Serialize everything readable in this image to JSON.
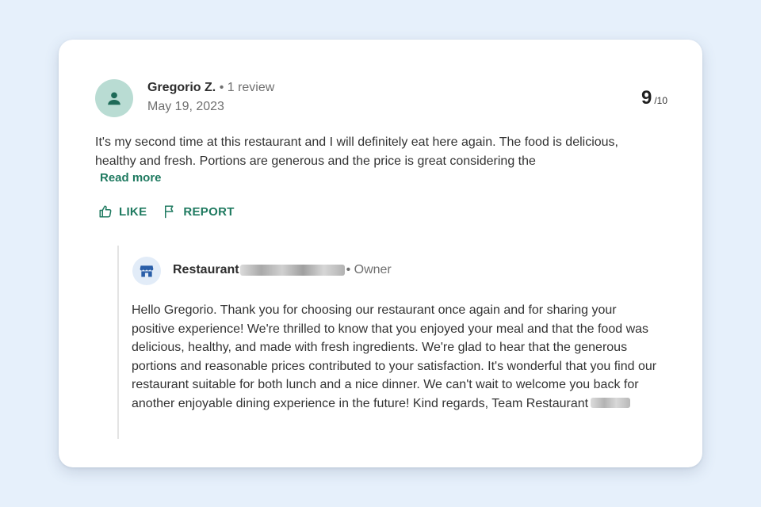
{
  "review": {
    "reviewer_name": "Gregorio Z.",
    "reviewer_meta": "• 1 review",
    "date": "May 19, 2023",
    "score": "9",
    "score_max": "/10",
    "text": "It's my second time at this restaurant and I will definitely eat here again. The food is delicious, healthy and fresh. Portions are generous and the price is great considering the",
    "read_more_label": "Read more",
    "actions": {
      "like_label": "LIKE",
      "report_label": "REPORT"
    }
  },
  "reply": {
    "owner_name": "Restaurant",
    "owner_role": "• Owner",
    "text": "Hello Gregorio. Thank you for choosing our restaurant once again and for sharing your positive experience! We're thrilled to know that you enjoyed your meal and that the food was delicious, healthy, and made with fresh ingredients. We're glad to hear that the generous portions and reasonable prices contributed to your satisfaction. It's wonderful that you find our restaurant suitable for both lunch and a nice dinner. We can't wait to welcome you back for another enjoyable dining experience in the future! Kind regards, Team Restaurant"
  },
  "icons": {
    "avatar": "person-icon",
    "owner_avatar": "storefront-icon",
    "like": "thumbs-up-icon",
    "report": "flag-icon"
  },
  "colors": {
    "accent": "#1f7a60",
    "avatar_bg": "#b9dcd3",
    "avatar_fg": "#1e6a58",
    "owner_avatar_bg": "#e2ecf8",
    "owner_icon": "#2a5ea8",
    "page_bg": "#e6f0fb"
  }
}
